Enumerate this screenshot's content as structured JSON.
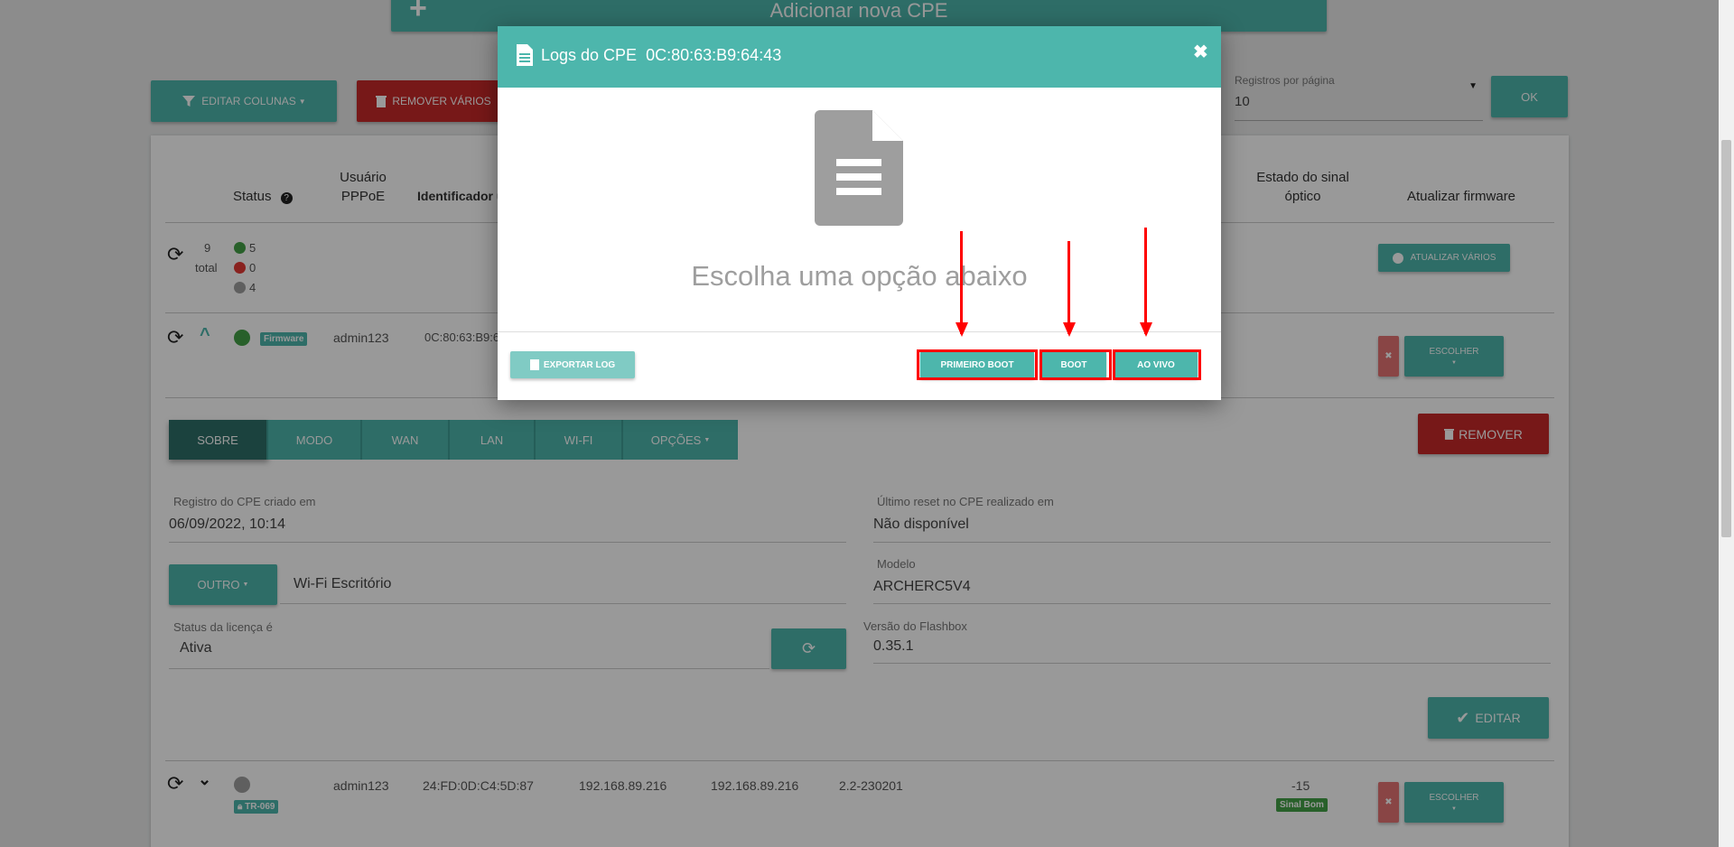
{
  "page": {
    "add_cpe_label": "Adicionar nova CPE",
    "edit_columns_label": "EDITAR COLUNAS",
    "remove_many_label": "REMOVER VÁRIOS",
    "per_page_label": "Registros por página",
    "per_page_value": "10",
    "ok_label": "OK"
  },
  "table": {
    "headers": {
      "status": "Status",
      "user_line1": "Usuário",
      "user_line2": "PPPoE",
      "identifier": "Identificador u",
      "signal_line1": "Estado do sinal",
      "signal_line2": "óptico",
      "firmware": "Atualizar firmware"
    },
    "summary": {
      "total_count": "9",
      "total_label": "total",
      "green_count": "5",
      "red_count": "0",
      "gray_count": "4",
      "update_many_label": "ATUALIZAR VÁRIOS"
    },
    "row1": {
      "badge": "Firmware",
      "user": "admin123",
      "identifier": "0C:80:63:B9:6",
      "choose_label": "ESCOLHER"
    },
    "row2": {
      "badge": "TR-069",
      "user": "admin123",
      "identifier": "24:FD:0D:C4:5D:87",
      "ip1": "192.168.89.216",
      "ip2": "192.168.89.216",
      "version": "2.2-230201",
      "signal_value": "-15",
      "signal_badge": "Sinal Bom",
      "choose_label": "ESCOLHER"
    }
  },
  "detail": {
    "tabs": [
      "SOBRE",
      "MODO",
      "WAN",
      "LAN",
      "WI-FI",
      "OPÇÕES"
    ],
    "remove_label": "REMOVER",
    "created_label": "Registro do CPE criado em",
    "created_value": "06/09/2022, 10:14",
    "reset_label": "Último reset no CPE realizado em",
    "reset_value": "Não disponível",
    "other_label": "OUTRO",
    "wifi_value": "Wi-Fi Escritório",
    "model_label": "Modelo",
    "model_value": "ARCHERC5V4",
    "license_label": "Status da licença é",
    "license_value": "Ativa",
    "flashbox_label": "Versão do Flashbox",
    "flashbox_value": "0.35.1",
    "edit_label": "EDITAR"
  },
  "modal": {
    "title": "Logs do CPE",
    "mac": "0C:80:63:B9:64:43",
    "prompt": "Escolha uma opção abaixo",
    "export_label": "EXPORTAR LOG",
    "first_boot_label": "PRIMEIRO BOOT",
    "boot_label": "BOOT",
    "live_label": "AO VIVO",
    "close_icon": "close-icon"
  },
  "colors": {
    "accent": "#4db6ac",
    "danger": "#c62828",
    "status_green": "#43a047",
    "status_red": "#e53935",
    "status_gray": "#9e9e9e",
    "annotation": "#ff0000"
  }
}
